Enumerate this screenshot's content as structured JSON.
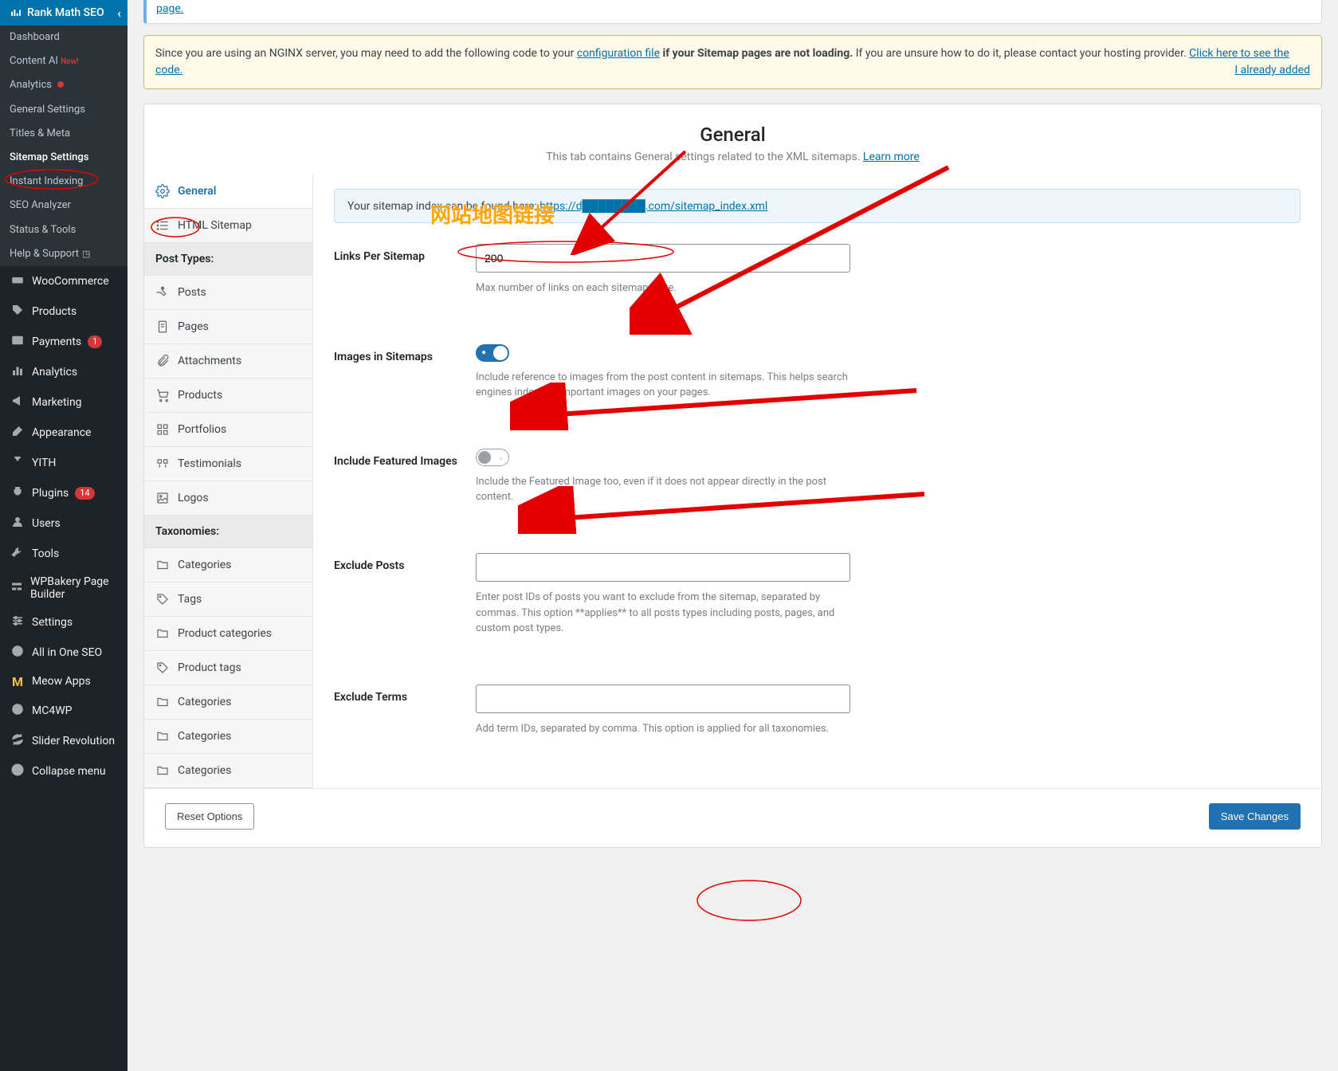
{
  "sidebar": {
    "brand": "Rank Math SEO",
    "submenu": [
      {
        "label": "Dashboard"
      },
      {
        "label": "Content AI",
        "new": true,
        "new_text": "New!"
      },
      {
        "label": "Analytics",
        "dot": true
      },
      {
        "label": "General Settings"
      },
      {
        "label": "Titles & Meta"
      },
      {
        "label": "Sitemap Settings",
        "active": true
      },
      {
        "label": "Instant Indexing"
      },
      {
        "label": "SEO Analyzer"
      },
      {
        "label": "Status & Tools"
      },
      {
        "label": "Help & Support",
        "ext": true
      }
    ],
    "menu": [
      {
        "label": "WooCommerce",
        "name": "sidebar-item-woocommerce",
        "icon": "woo"
      },
      {
        "label": "Products",
        "name": "sidebar-item-products",
        "icon": "tag"
      },
      {
        "label": "Payments",
        "name": "sidebar-item-payments",
        "icon": "dollar",
        "badge": "1"
      },
      {
        "label": "Analytics",
        "name": "sidebar-item-analytics",
        "icon": "chart"
      },
      {
        "label": "Marketing",
        "name": "sidebar-item-marketing",
        "icon": "megaphone"
      },
      {
        "label": "Appearance",
        "name": "sidebar-item-appearance",
        "icon": "brush"
      },
      {
        "label": "YITH",
        "name": "sidebar-item-yith",
        "icon": "yith"
      },
      {
        "label": "Plugins",
        "name": "sidebar-item-plugins",
        "icon": "plug",
        "badge": "14"
      },
      {
        "label": "Users",
        "name": "sidebar-item-users",
        "icon": "user"
      },
      {
        "label": "Tools",
        "name": "sidebar-item-tools",
        "icon": "wrench"
      },
      {
        "label": "WPBakery Page Builder",
        "name": "sidebar-item-wpbakery",
        "icon": "wpb"
      },
      {
        "label": "Settings",
        "name": "sidebar-item-settings",
        "icon": "sliders"
      },
      {
        "label": "All in One SEO",
        "name": "sidebar-item-aioseo",
        "icon": "aio"
      },
      {
        "label": "Meow Apps",
        "name": "sidebar-item-meow",
        "icon": "meow"
      },
      {
        "label": "MC4WP",
        "name": "sidebar-item-mc4wp",
        "icon": "mc4"
      },
      {
        "label": "Slider Revolution",
        "name": "sidebar-item-slider",
        "icon": "refresh"
      },
      {
        "label": "Collapse menu",
        "name": "sidebar-item-collapse",
        "icon": "collapse"
      }
    ]
  },
  "notice_clip": {
    "link": "page."
  },
  "notice_nginx": {
    "text_a": "Since you are using an NGINX server, you may need to add the following code to your ",
    "link_a": "configuration file",
    "text_b": " if your Sitemap pages are not loading.",
    "text_c": " If you are unsure how to do it, please contact your hosting provider. ",
    "link_b": "Click here to see the code.",
    "already": "I already added"
  },
  "header": {
    "title": "General",
    "subtitle": "This tab contains General settings related to the XML sitemaps. ",
    "learn_more": "Learn more"
  },
  "tabs": {
    "general": "General",
    "html": "HTML Sitemap",
    "post_types": "Post Types:",
    "posts": "Posts",
    "pages": "Pages",
    "attachments": "Attachments",
    "products": "Products",
    "portfolios": "Portfolios",
    "testimonials": "Testimonials",
    "logos": "Logos",
    "taxonomies": "Taxonomies:",
    "categories": "Categories",
    "tags": "Tags",
    "product_categories": "Product categories",
    "product_tags": "Product tags",
    "categories2": "Categories",
    "categories3": "Categories",
    "categories4": "Categories"
  },
  "form": {
    "sitemap_intro": "Your sitemap index can be found here: ",
    "sitemap_url": "https://d████████.com/sitemap_index.xml",
    "links_label": "Links Per Sitemap",
    "links_value": "200",
    "links_desc": "Max number of links on each sitemap page.",
    "images_label": "Images in Sitemaps",
    "images_on": true,
    "images_desc": "Include reference to images from the post content in sitemaps. This helps search engines index the important images on your pages.",
    "featured_label": "Include Featured Images",
    "featured_on": false,
    "featured_desc": "Include the Featured Image too, even if it does not appear directly in the post content.",
    "exclude_p_label": "Exclude Posts",
    "exclude_p_value": "",
    "exclude_p_desc": "Enter post IDs of posts you want to exclude from the sitemap, separated by commas. This option **applies** to all posts types including posts, pages, and custom post types.",
    "exclude_t_label": "Exclude Terms",
    "exclude_t_value": "",
    "exclude_t_desc": "Add term IDs, separated by comma. This option is applied for all taxonomies."
  },
  "buttons": {
    "reset": "Reset Options",
    "save": "Save Changes"
  },
  "annotations": {
    "sitemap_text": "网站地图链接"
  }
}
